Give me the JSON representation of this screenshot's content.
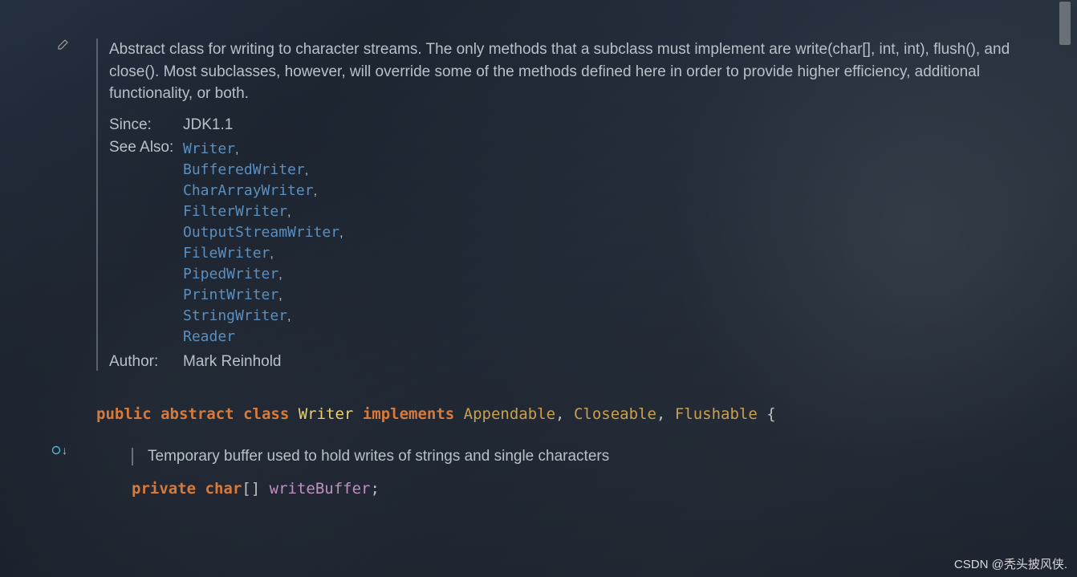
{
  "doc": {
    "description": "Abstract class for writing to character streams. The only methods that a subclass must implement are write(char[], int, int), flush(), and close(). Most subclasses, however, will override some of the methods defined here in order to provide higher efficiency, additional functionality, or both.",
    "since_label": "Since:",
    "since_value": "JDK1.1",
    "see_also_label": "See Also:",
    "see_also": [
      "Writer",
      "BufferedWriter",
      "CharArrayWriter",
      "FilterWriter",
      "OutputStreamWriter",
      "FileWriter",
      "PipedWriter",
      "PrintWriter",
      "StringWriter",
      "Reader"
    ],
    "author_label": "Author:",
    "author_value": "Mark Reinhold"
  },
  "code": {
    "kw_public": "public",
    "kw_abstract": "abstract",
    "kw_class": "class",
    "class_name": "Writer",
    "kw_implements": "implements",
    "iface1": "Appendable",
    "iface2": "Closeable",
    "iface3": "Flushable",
    "brace_open": "{",
    "inner_doc": "Temporary buffer used to hold writes of strings and single characters",
    "kw_private": "private",
    "kw_char": "char",
    "brackets": "[]",
    "field_name": "writeBuffer",
    "semicolon": ";"
  },
  "watermark": "CSDN @秃头披风侠."
}
